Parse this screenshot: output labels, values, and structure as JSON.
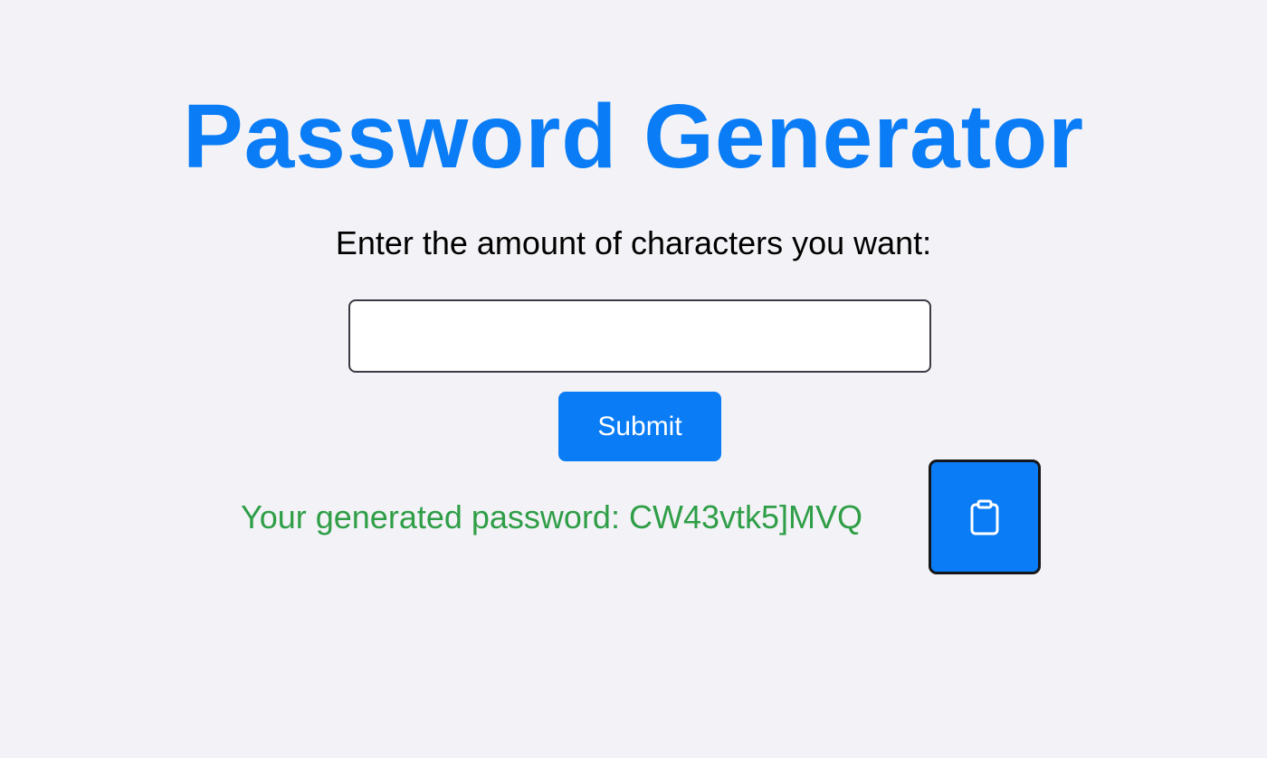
{
  "header": {
    "title": "Password Generator"
  },
  "form": {
    "prompt": "Enter the amount of characters you want:",
    "length_value": "",
    "length_placeholder": "",
    "submit_label": "Submit"
  },
  "result": {
    "label": "Your generated password: ",
    "password": "CW43vtk5]MVQ"
  },
  "icons": {
    "copy": "clipboard-icon"
  },
  "colors": {
    "accent": "#0a7cf5",
    "success": "#2f9e47",
    "background": "#f3f3f7"
  }
}
